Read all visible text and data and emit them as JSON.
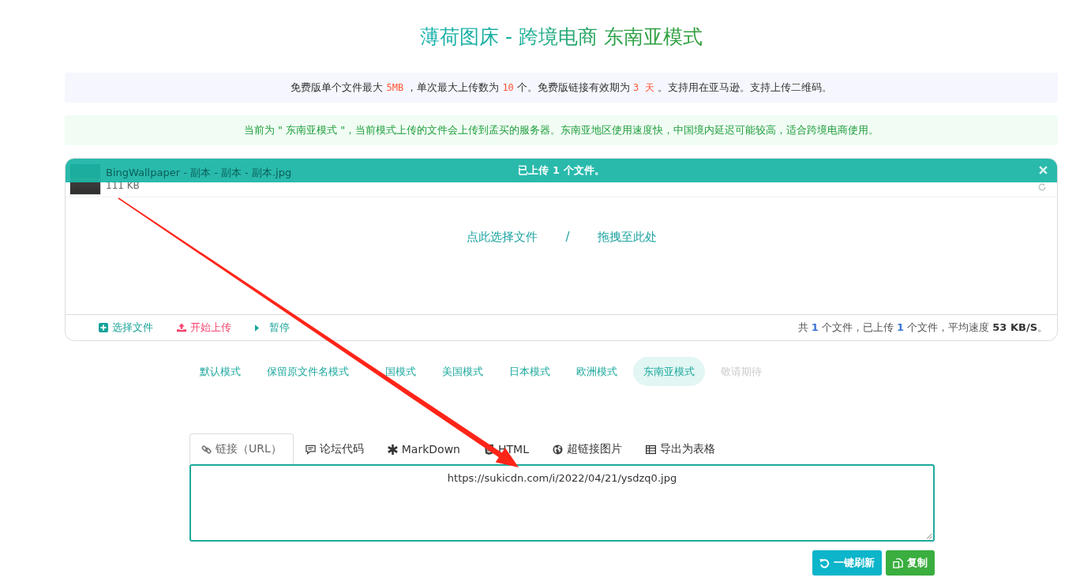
{
  "title": "薄荷图床 - 跨境电商 东南亚模式",
  "notices": [
    {
      "kind": "info",
      "segments": [
        {
          "text": "免费版单个文件最大 ",
          "kind": "plain"
        },
        {
          "text": "5MB",
          "kind": "code"
        },
        {
          "text": " ，单次最大上传数为 ",
          "kind": "plain"
        },
        {
          "text": "10",
          "kind": "code"
        },
        {
          "text": " 个。免费版链接有效期为 ",
          "kind": "plain"
        },
        {
          "text": "3 天",
          "kind": "code"
        },
        {
          "text": " 。支持用在亚马逊。支持上传二维码。",
          "kind": "plain"
        }
      ]
    },
    {
      "kind": "success",
      "segments": [
        {
          "text": "当前为 \" 东南亚模式 \"，当前模式上传的文件会上传到孟买的服务器。东南亚地区使用速度快，中国境内延迟可能较高，适合跨境电商使用。",
          "kind": "plain"
        }
      ]
    }
  ],
  "upload": {
    "status": "已上传 1 个文件。",
    "files": [
      {
        "name": "BingWallpaper - 副本 - 副本 - 副本.jpg",
        "size": "111 KB"
      }
    ],
    "drop_zone": {
      "pick": "点此选择文件",
      "separator": "/",
      "drag": "拖拽至此处"
    },
    "actions": [
      {
        "label": "选择文件",
        "kind": "add"
      },
      {
        "label": "开始上传",
        "kind": "upload"
      },
      {
        "label": "暂停",
        "kind": "pause"
      }
    ],
    "stats": [
      {
        "text": "共 ",
        "kind": "plain"
      },
      {
        "text": "1",
        "kind": "count"
      },
      {
        "text": " 个文件，已上传 ",
        "kind": "plain"
      },
      {
        "text": "1",
        "kind": "count"
      },
      {
        "text": " 个文件，平均速度 ",
        "kind": "plain"
      },
      {
        "text": "53 KB/S",
        "kind": "strong"
      },
      {
        "text": "。",
        "kind": "plain"
      }
    ]
  },
  "modes": [
    {
      "label": "默认模式",
      "selected": false,
      "disabled": false
    },
    {
      "label": "保留原文件名模式",
      "selected": false,
      "disabled": false
    },
    {
      "label": "国模式",
      "selected": false,
      "disabled": false
    },
    {
      "label": "美国模式",
      "selected": false,
      "disabled": false
    },
    {
      "label": "日本模式",
      "selected": false,
      "disabled": false
    },
    {
      "label": "欧洲模式",
      "selected": false,
      "disabled": false
    },
    {
      "label": "东南亚模式",
      "selected": true,
      "disabled": false
    },
    {
      "label": "敬请期待",
      "selected": false,
      "disabled": true
    }
  ],
  "output": {
    "tabs": [
      {
        "label": "链接（URL）",
        "kind": "url",
        "selected": true
      },
      {
        "label": "论坛代码",
        "kind": "bbcode",
        "selected": false
      },
      {
        "label": "MarkDown",
        "kind": "markdown",
        "selected": false
      },
      {
        "label": "HTML",
        "kind": "html",
        "selected": false
      },
      {
        "label": "超链接图片",
        "kind": "linked_image",
        "selected": false
      },
      {
        "label": "导出为表格",
        "kind": "spreadsheet",
        "selected": false
      }
    ],
    "value": "https://sukicdn.com/i/2022/04/21/ysdzq0.jpg",
    "buttons": [
      {
        "label": "一键刷新",
        "kind": "refresh"
      },
      {
        "label": "复制",
        "kind": "copy"
      }
    ]
  },
  "annotations": [
    {
      "kind": "arrow"
    }
  ]
}
